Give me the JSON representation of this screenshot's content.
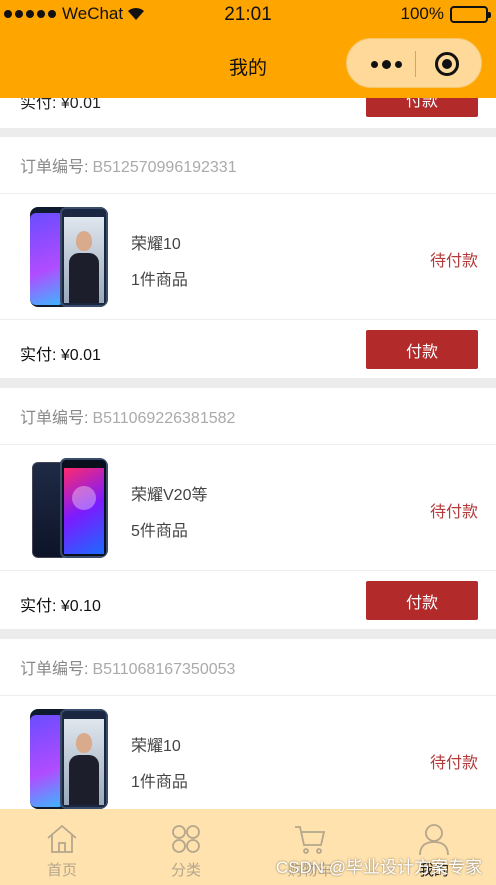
{
  "status_bar": {
    "carrier": "WeChat",
    "time": "21:01",
    "battery": "100%"
  },
  "nav": {
    "title": "我的"
  },
  "partial_order": {
    "paid_label": "实付: ¥0.01",
    "pay_button": "付款"
  },
  "orders": [
    {
      "order_no_label": "订单编号:",
      "order_no": "B512570996192331",
      "goods_name": "荣耀10",
      "goods_count": "1件商品",
      "status": "待付款",
      "paid_label": "实付: ¥0.01",
      "pay_button": "付款"
    },
    {
      "order_no_label": "订单编号:",
      "order_no": "B511069226381582",
      "goods_name": "荣耀V20等",
      "goods_count": "5件商品",
      "status": "待付款",
      "paid_label": "实付: ¥0.10",
      "pay_button": "付款"
    },
    {
      "order_no_label": "订单编号:",
      "order_no": "B511068167350053",
      "goods_name": "荣耀10",
      "goods_count": "1件商品",
      "status": "待付款",
      "paid_label": "",
      "pay_button": ""
    }
  ],
  "tabbar": [
    {
      "label": "首页",
      "icon": "home-icon"
    },
    {
      "label": "分类",
      "icon": "category-icon"
    },
    {
      "label": "购物车",
      "icon": "cart-icon"
    },
    {
      "label": "我的",
      "icon": "user-icon"
    }
  ],
  "watermark": "CSDN @毕业设计方案专家",
  "colors": {
    "header": "#ffa500",
    "tabbar": "#ffe2ad",
    "pay_button": "#b22a2a",
    "status": "#b43b3b"
  }
}
